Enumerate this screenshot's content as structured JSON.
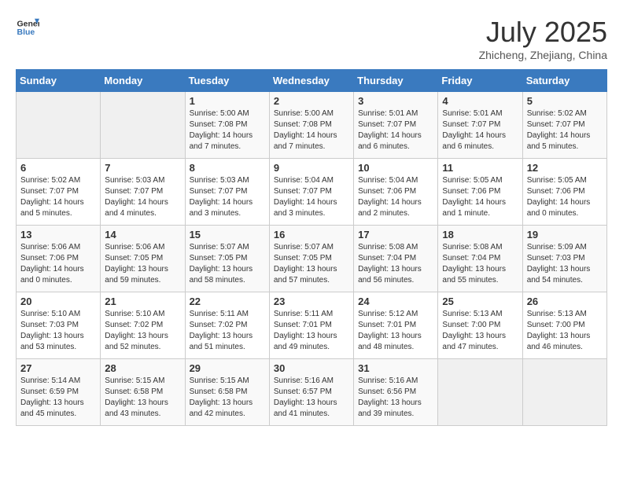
{
  "logo": {
    "line1": "General",
    "line2": "Blue"
  },
  "title": "July 2025",
  "subtitle": "Zhicheng, Zhejiang, China",
  "weekdays": [
    "Sunday",
    "Monday",
    "Tuesday",
    "Wednesday",
    "Thursday",
    "Friday",
    "Saturday"
  ],
  "weeks": [
    [
      {
        "day": "",
        "detail": ""
      },
      {
        "day": "",
        "detail": ""
      },
      {
        "day": "1",
        "detail": "Sunrise: 5:00 AM\nSunset: 7:08 PM\nDaylight: 14 hours\nand 7 minutes."
      },
      {
        "day": "2",
        "detail": "Sunrise: 5:00 AM\nSunset: 7:08 PM\nDaylight: 14 hours\nand 7 minutes."
      },
      {
        "day": "3",
        "detail": "Sunrise: 5:01 AM\nSunset: 7:07 PM\nDaylight: 14 hours\nand 6 minutes."
      },
      {
        "day": "4",
        "detail": "Sunrise: 5:01 AM\nSunset: 7:07 PM\nDaylight: 14 hours\nand 6 minutes."
      },
      {
        "day": "5",
        "detail": "Sunrise: 5:02 AM\nSunset: 7:07 PM\nDaylight: 14 hours\nand 5 minutes."
      }
    ],
    [
      {
        "day": "6",
        "detail": "Sunrise: 5:02 AM\nSunset: 7:07 PM\nDaylight: 14 hours\nand 5 minutes."
      },
      {
        "day": "7",
        "detail": "Sunrise: 5:03 AM\nSunset: 7:07 PM\nDaylight: 14 hours\nand 4 minutes."
      },
      {
        "day": "8",
        "detail": "Sunrise: 5:03 AM\nSunset: 7:07 PM\nDaylight: 14 hours\nand 3 minutes."
      },
      {
        "day": "9",
        "detail": "Sunrise: 5:04 AM\nSunset: 7:07 PM\nDaylight: 14 hours\nand 3 minutes."
      },
      {
        "day": "10",
        "detail": "Sunrise: 5:04 AM\nSunset: 7:06 PM\nDaylight: 14 hours\nand 2 minutes."
      },
      {
        "day": "11",
        "detail": "Sunrise: 5:05 AM\nSunset: 7:06 PM\nDaylight: 14 hours\nand 1 minute."
      },
      {
        "day": "12",
        "detail": "Sunrise: 5:05 AM\nSunset: 7:06 PM\nDaylight: 14 hours\nand 0 minutes."
      }
    ],
    [
      {
        "day": "13",
        "detail": "Sunrise: 5:06 AM\nSunset: 7:06 PM\nDaylight: 14 hours\nand 0 minutes."
      },
      {
        "day": "14",
        "detail": "Sunrise: 5:06 AM\nSunset: 7:05 PM\nDaylight: 13 hours\nand 59 minutes."
      },
      {
        "day": "15",
        "detail": "Sunrise: 5:07 AM\nSunset: 7:05 PM\nDaylight: 13 hours\nand 58 minutes."
      },
      {
        "day": "16",
        "detail": "Sunrise: 5:07 AM\nSunset: 7:05 PM\nDaylight: 13 hours\nand 57 minutes."
      },
      {
        "day": "17",
        "detail": "Sunrise: 5:08 AM\nSunset: 7:04 PM\nDaylight: 13 hours\nand 56 minutes."
      },
      {
        "day": "18",
        "detail": "Sunrise: 5:08 AM\nSunset: 7:04 PM\nDaylight: 13 hours\nand 55 minutes."
      },
      {
        "day": "19",
        "detail": "Sunrise: 5:09 AM\nSunset: 7:03 PM\nDaylight: 13 hours\nand 54 minutes."
      }
    ],
    [
      {
        "day": "20",
        "detail": "Sunrise: 5:10 AM\nSunset: 7:03 PM\nDaylight: 13 hours\nand 53 minutes."
      },
      {
        "day": "21",
        "detail": "Sunrise: 5:10 AM\nSunset: 7:02 PM\nDaylight: 13 hours\nand 52 minutes."
      },
      {
        "day": "22",
        "detail": "Sunrise: 5:11 AM\nSunset: 7:02 PM\nDaylight: 13 hours\nand 51 minutes."
      },
      {
        "day": "23",
        "detail": "Sunrise: 5:11 AM\nSunset: 7:01 PM\nDaylight: 13 hours\nand 49 minutes."
      },
      {
        "day": "24",
        "detail": "Sunrise: 5:12 AM\nSunset: 7:01 PM\nDaylight: 13 hours\nand 48 minutes."
      },
      {
        "day": "25",
        "detail": "Sunrise: 5:13 AM\nSunset: 7:00 PM\nDaylight: 13 hours\nand 47 minutes."
      },
      {
        "day": "26",
        "detail": "Sunrise: 5:13 AM\nSunset: 7:00 PM\nDaylight: 13 hours\nand 46 minutes."
      }
    ],
    [
      {
        "day": "27",
        "detail": "Sunrise: 5:14 AM\nSunset: 6:59 PM\nDaylight: 13 hours\nand 45 minutes."
      },
      {
        "day": "28",
        "detail": "Sunrise: 5:15 AM\nSunset: 6:58 PM\nDaylight: 13 hours\nand 43 minutes."
      },
      {
        "day": "29",
        "detail": "Sunrise: 5:15 AM\nSunset: 6:58 PM\nDaylight: 13 hours\nand 42 minutes."
      },
      {
        "day": "30",
        "detail": "Sunrise: 5:16 AM\nSunset: 6:57 PM\nDaylight: 13 hours\nand 41 minutes."
      },
      {
        "day": "31",
        "detail": "Sunrise: 5:16 AM\nSunset: 6:56 PM\nDaylight: 13 hours\nand 39 minutes."
      },
      {
        "day": "",
        "detail": ""
      },
      {
        "day": "",
        "detail": ""
      }
    ]
  ]
}
